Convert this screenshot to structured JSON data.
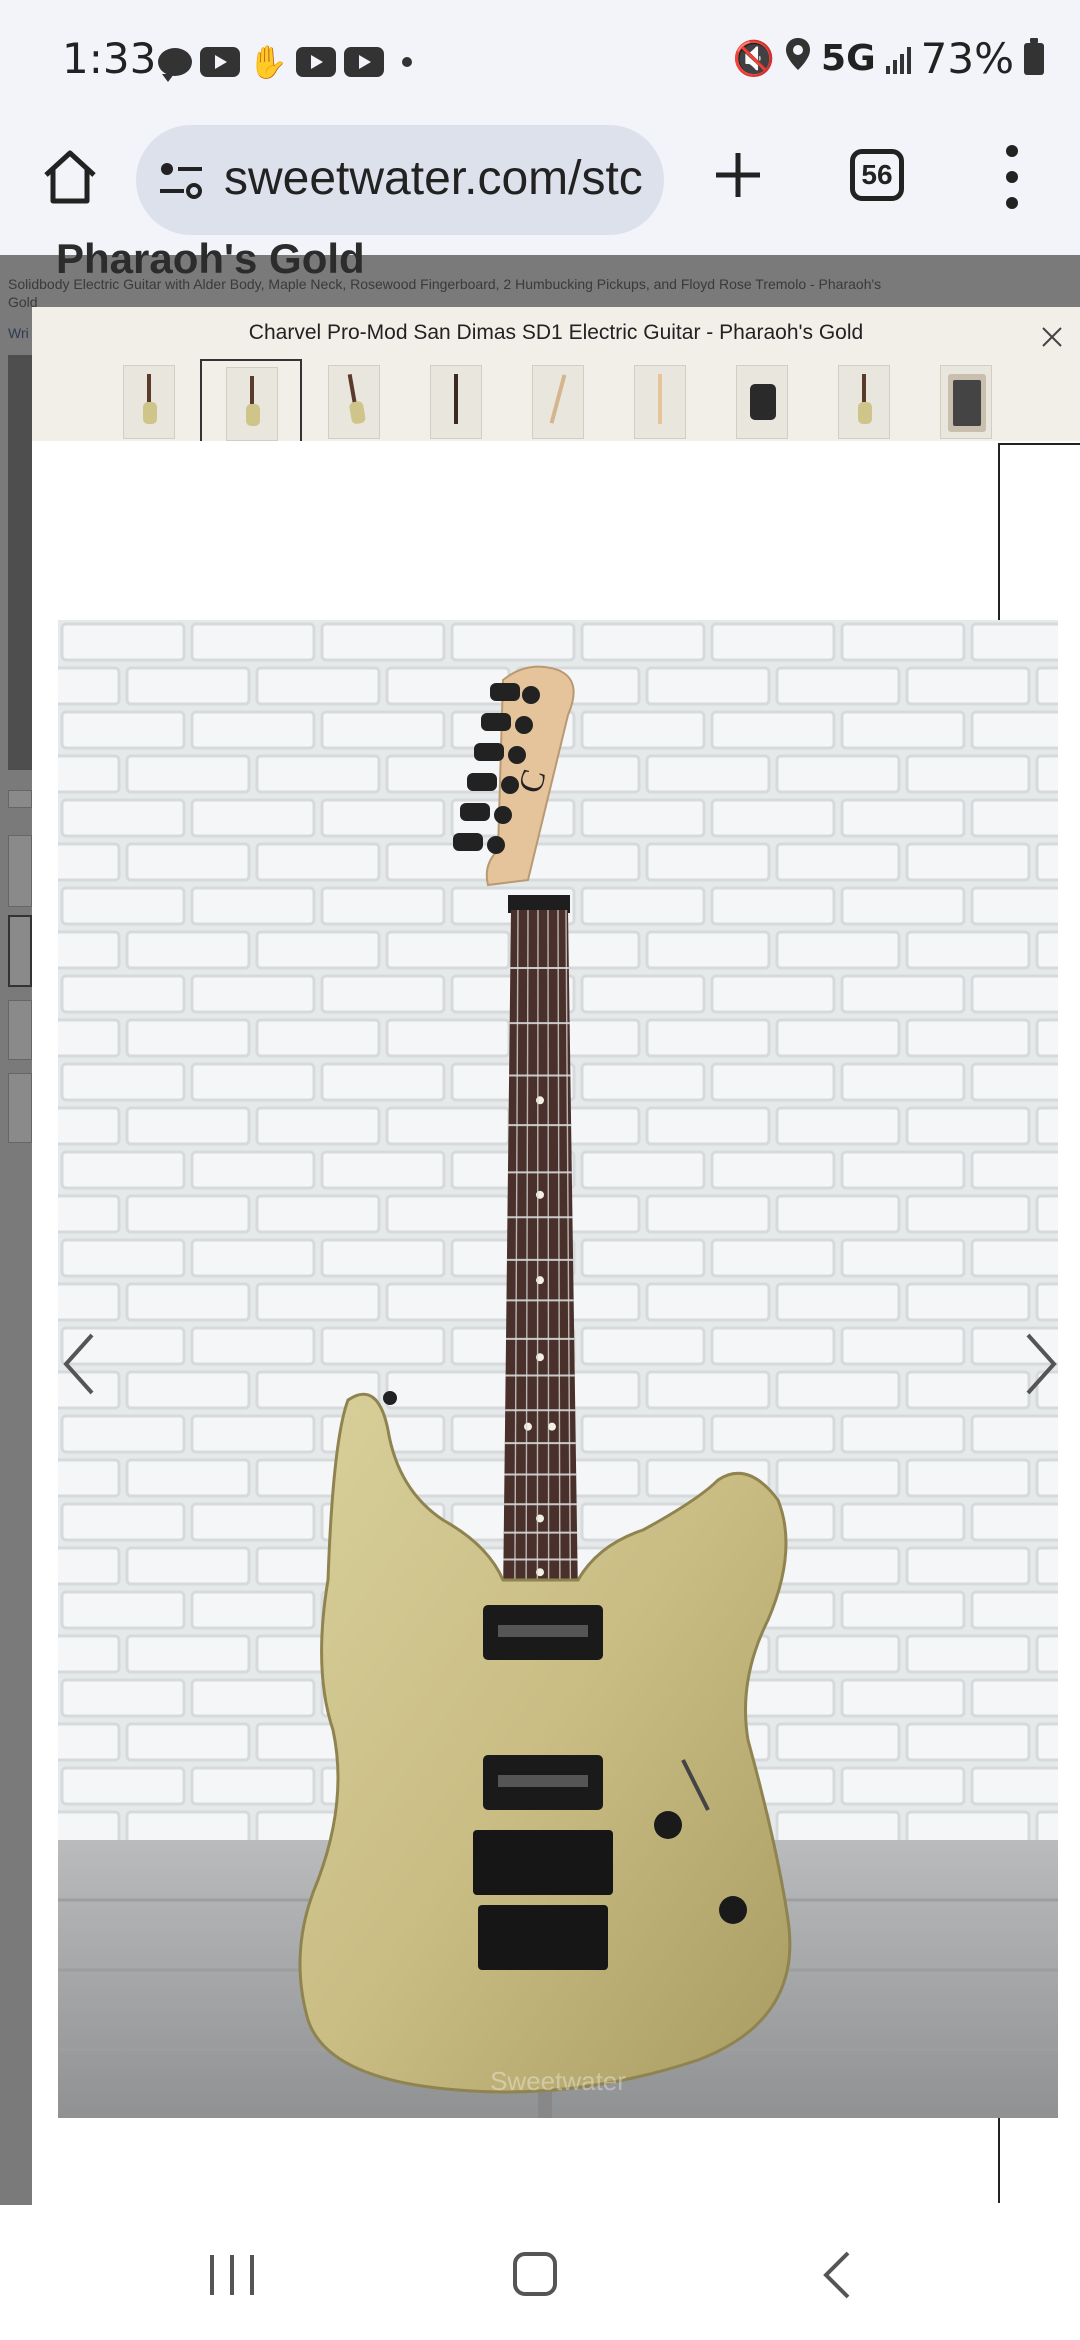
{
  "status_bar": {
    "time": "1:33",
    "network": "5G",
    "battery": "73%"
  },
  "browser": {
    "url": "sweetwater.com/stc",
    "tab_count": "56"
  },
  "background_page": {
    "title": "Pharaoh's Gold",
    "subtitle": "Solidbody Electric Guitar with Alder Body, Maple Neck, Rosewood Fingerboard, 2 Humbucking Pickups, and Floyd Rose Tremolo - Pharaoh's Gold",
    "write_link": "Wri"
  },
  "modal": {
    "title": "Charvel Pro-Mod San Dimas SD1 Electric Guitar - Pharaoh's Gold",
    "selected_thumbnail_index": 1,
    "thumbnail_count": 9
  },
  "colors": {
    "guitar_body": "#c9bd84",
    "fingerboard": "#4a302a",
    "headstock": "#e5c49c",
    "brick_wall": "#eef0f1",
    "floor": "#a9a9a9"
  }
}
